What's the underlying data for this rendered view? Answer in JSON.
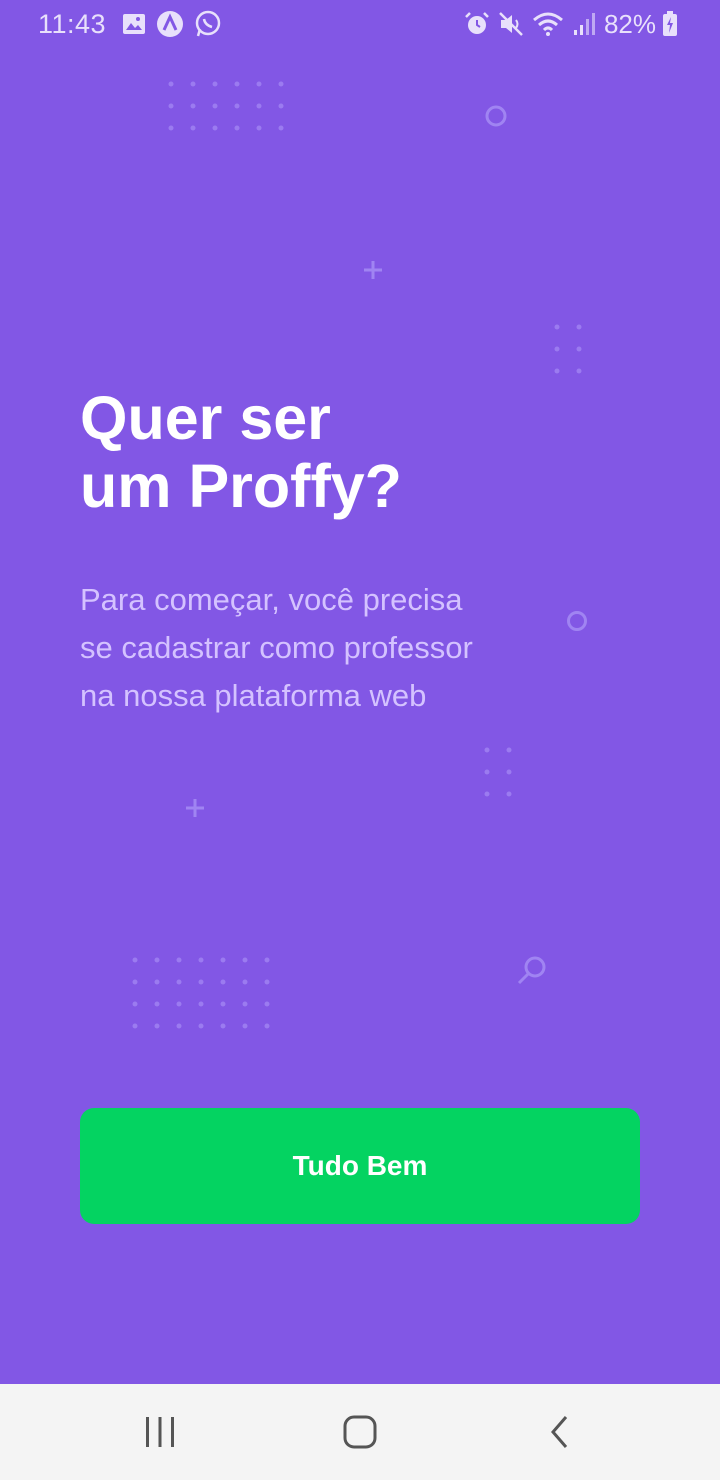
{
  "status_bar": {
    "time": "11:43",
    "battery_percent": "82%",
    "left_icons": [
      "gallery-icon",
      "app-icon",
      "whatsapp-icon"
    ],
    "right_icons": [
      "alarm-icon",
      "mute-icon",
      "wifi-icon",
      "signal-icon",
      "battery-charging-icon"
    ]
  },
  "content": {
    "title_lines": [
      "Quer ser",
      "um Proffy?"
    ],
    "description_lines": [
      "Para começar, você precisa",
      "se cadastrar como professor",
      "na nossa plataforma web"
    ]
  },
  "button": {
    "label": "Tudo Bem"
  },
  "nav_bar": {
    "buttons": [
      "recent-apps",
      "home",
      "back"
    ]
  },
  "colors": {
    "background": "#8257e5",
    "button": "#04d361",
    "title_text": "#ffffff",
    "description_text": "#d4c2ff",
    "nav_bar": "#f4f4f4"
  }
}
